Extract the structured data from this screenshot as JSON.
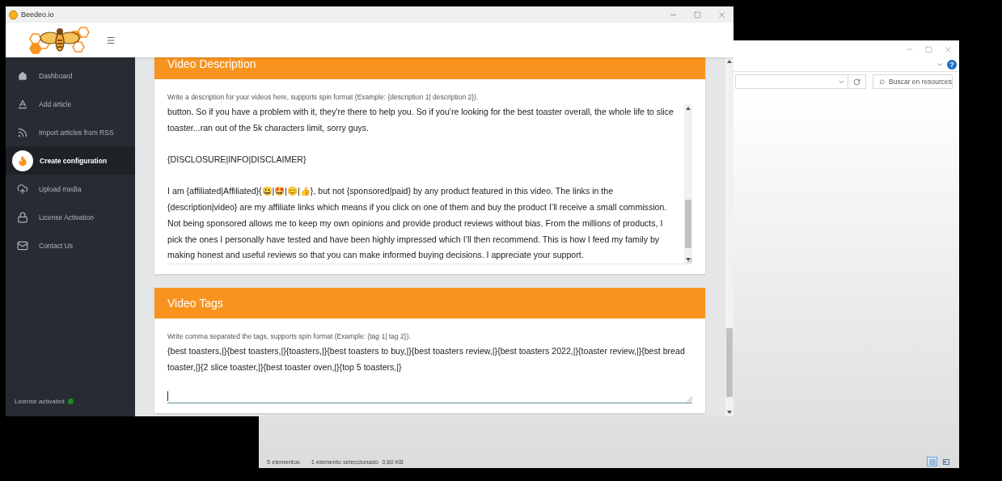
{
  "app_window": {
    "title": "Beedeo.io",
    "sidebar": {
      "items": [
        {
          "label": "Dashboard",
          "selected": false
        },
        {
          "label": "Add article",
          "selected": false
        },
        {
          "label": "Import articles from RSS",
          "selected": false
        },
        {
          "label": "Create configuration",
          "selected": true
        },
        {
          "label": "Upload media",
          "selected": false
        },
        {
          "label": "License Activation",
          "selected": false
        },
        {
          "label": "Contact Us",
          "selected": false
        }
      ],
      "license_status": "License activated",
      "license_active": true
    },
    "sections": [
      {
        "title": "Video Description",
        "hint": "Write a description for your videos here, supports spin format (Example: {description 1| description 2}).",
        "value": [
          "button. So if you have a problem with it, they're there to help you. So if you're looking for the best toaster overall, the whole life to slice toaster...ran out of the 5k characters limit, sorry guys.",
          "{DISCLOSURE|INFO|DISCLAIMER}",
          "I am {affiliated|Affiliated}{😃|🤩|😊|👍}, but not {sponsored|paid} by any product featured in this video. The links in the {description|video} are my affiliate links which means if you click on one of them and buy the product I’ll receive a small commission. Not being sponsored allows me to keep my own opinions and provide product reviews without bias. From the millions of products, I pick the ones I personally have tested and have been highly impressed which I’ll then recommend. This is how I feed my family by making honest and useful reviews so that you can make informed buying decisions. I appreciate your support."
        ],
        "kind": "scrolling"
      },
      {
        "title": "Video Tags",
        "hint": "Write comma separated the tags, supports spin format (Example: {tag 1| tag 2}).",
        "value": [
          "{best toasters,|}{best toasters,|}{toasters,|}{best toasters to buy,|}{best toasters review,|}{best toasters 2022,|}{toaster review,|}{best bread toaster,|}{2 slice toaster,|}{best toaster oven,|}{top 5 toasters,|}"
        ],
        "kind": "focused"
      }
    ]
  },
  "explorer_window": {
    "help": "?",
    "search": {
      "placeholder": "Buscar en resources"
    },
    "status_bar": {
      "item_count": "5 elementos",
      "selection": "1 elemento seleccionado",
      "size": "3,60 KB"
    }
  }
}
